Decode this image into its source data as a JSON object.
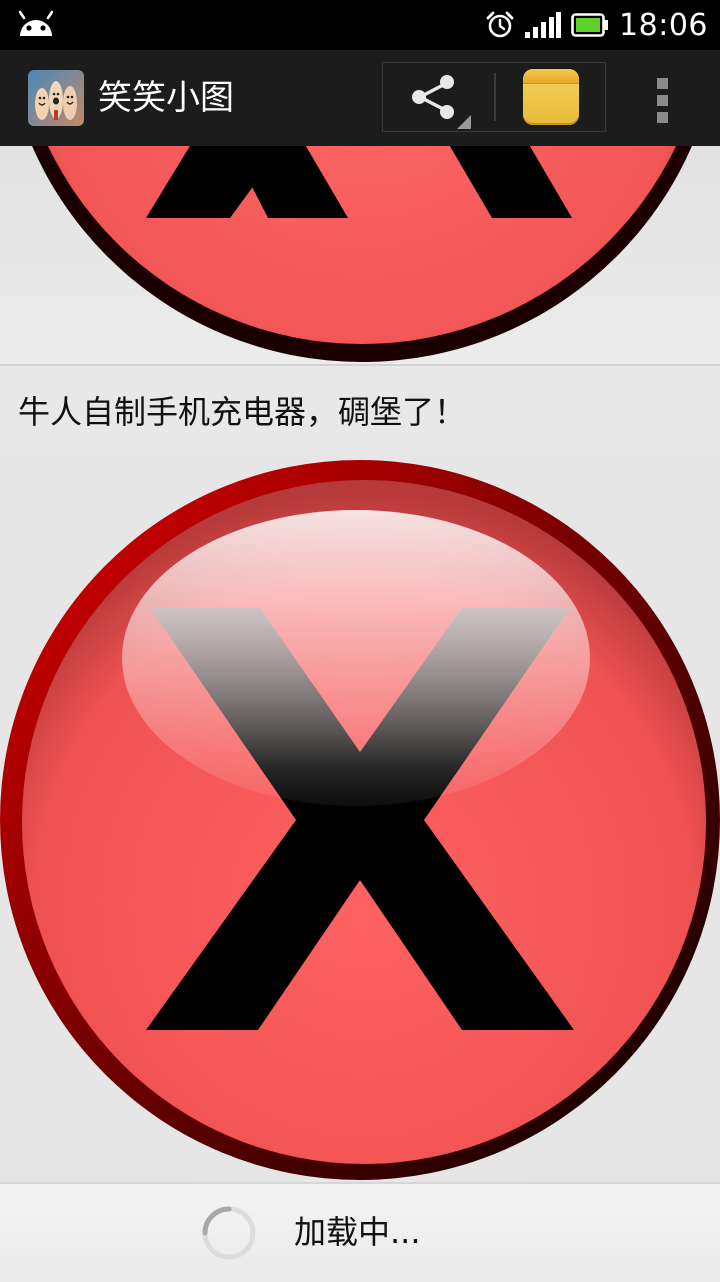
{
  "status_bar": {
    "time": "18:06",
    "icons": [
      "android-icon",
      "alarm-icon",
      "signal-icon",
      "battery-icon"
    ]
  },
  "action_bar": {
    "title": "笑笑小图",
    "actions": [
      {
        "name": "share",
        "icon": "share-icon"
      },
      {
        "name": "note",
        "icon": "note-icon"
      },
      {
        "name": "overflow",
        "icon": "overflow-menu-icon"
      }
    ]
  },
  "feed": {
    "items": [
      {
        "title": "",
        "image": "broken-image-x-icon"
      },
      {
        "title": "牛人自制手机充电器，碉堡了！",
        "image": "broken-image-x-icon"
      }
    ]
  },
  "footer": {
    "loading_text": "加载中..."
  },
  "colors": {
    "status_bar": "#000000",
    "action_bar": "#1c1c1c",
    "background": "#e8e8e8",
    "x_circle_red": "#ff5a5a",
    "x_circle_rim": "#a00000"
  }
}
